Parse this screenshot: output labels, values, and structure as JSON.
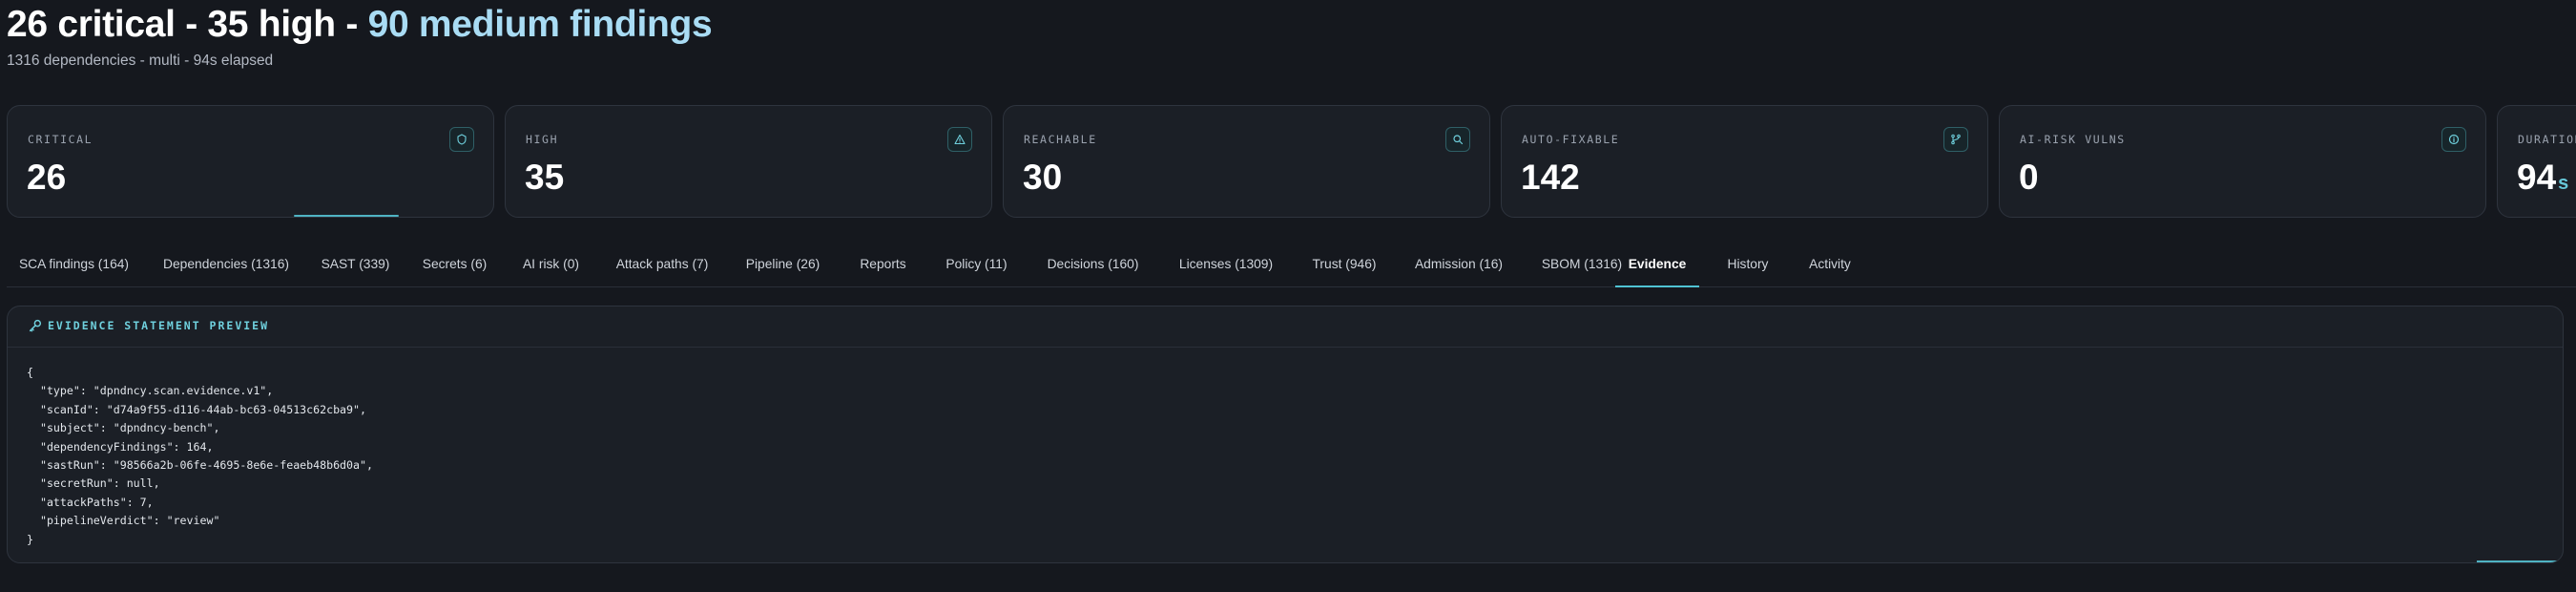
{
  "header": {
    "title_plain": "26 critical - 35 high - ",
    "title_accent": "90 medium findings",
    "subtitle": "1316 dependencies - multi - 94s elapsed"
  },
  "cards": [
    {
      "label": "CRITICAL",
      "value": "26",
      "icon": "shield-icon"
    },
    {
      "label": "HIGH",
      "value": "35",
      "icon": "warning-triangle-icon"
    },
    {
      "label": "REACHABLE",
      "value": "30",
      "icon": "search-icon"
    },
    {
      "label": "AUTO-FIXABLE",
      "value": "142",
      "icon": "git-branch-icon"
    },
    {
      "label": "AI-RISK VULNS",
      "value": "0",
      "icon": "info-circle-icon"
    },
    {
      "label": "DURATION",
      "value": "94",
      "unit": "s"
    }
  ],
  "tabs": [
    {
      "label": "SCA findings (164)"
    },
    {
      "label": "Dependencies (1316)"
    },
    {
      "label": "SAST (339)"
    },
    {
      "label": "Secrets (6)"
    },
    {
      "label": "AI risk (0)"
    },
    {
      "label": "Attack paths (7)"
    },
    {
      "label": "Pipeline (26)"
    },
    {
      "label": "Reports"
    },
    {
      "label": "Policy (11)"
    },
    {
      "label": "Decisions (160)"
    },
    {
      "label": "Licenses (1309)"
    },
    {
      "label": "Trust (946)"
    },
    {
      "label": "Admission (16)"
    },
    {
      "label": "SBOM (1316)"
    },
    {
      "label": "Evidence"
    },
    {
      "label": "History"
    },
    {
      "label": "Activity"
    }
  ],
  "active_tab": "Evidence",
  "evidence": {
    "title": "EVIDENCE STATEMENT PREVIEW",
    "lines": [
      "{",
      "  \"type\": \"dpndncy.scan.evidence.v1\",",
      "  \"scanId\": \"d74a9f55-d116-44ab-bc63-04513c62cba9\",",
      "  \"subject\": \"dpndncy-bench\",",
      "  \"dependencyFindings\": 164,",
      "  \"sastRun\": \"98566a2b-06fe-4695-8e6e-feaeb48b6d0a\",",
      "  \"secretRun\": null,",
      "  \"attackPaths\": 7,",
      "  \"pipelineVerdict\": \"review\"",
      "}"
    ]
  },
  "colors": {
    "background": "#15181e",
    "card": "#1b1f26",
    "accent": "#4fc3d3",
    "title_accent": "#a9dcf4"
  }
}
